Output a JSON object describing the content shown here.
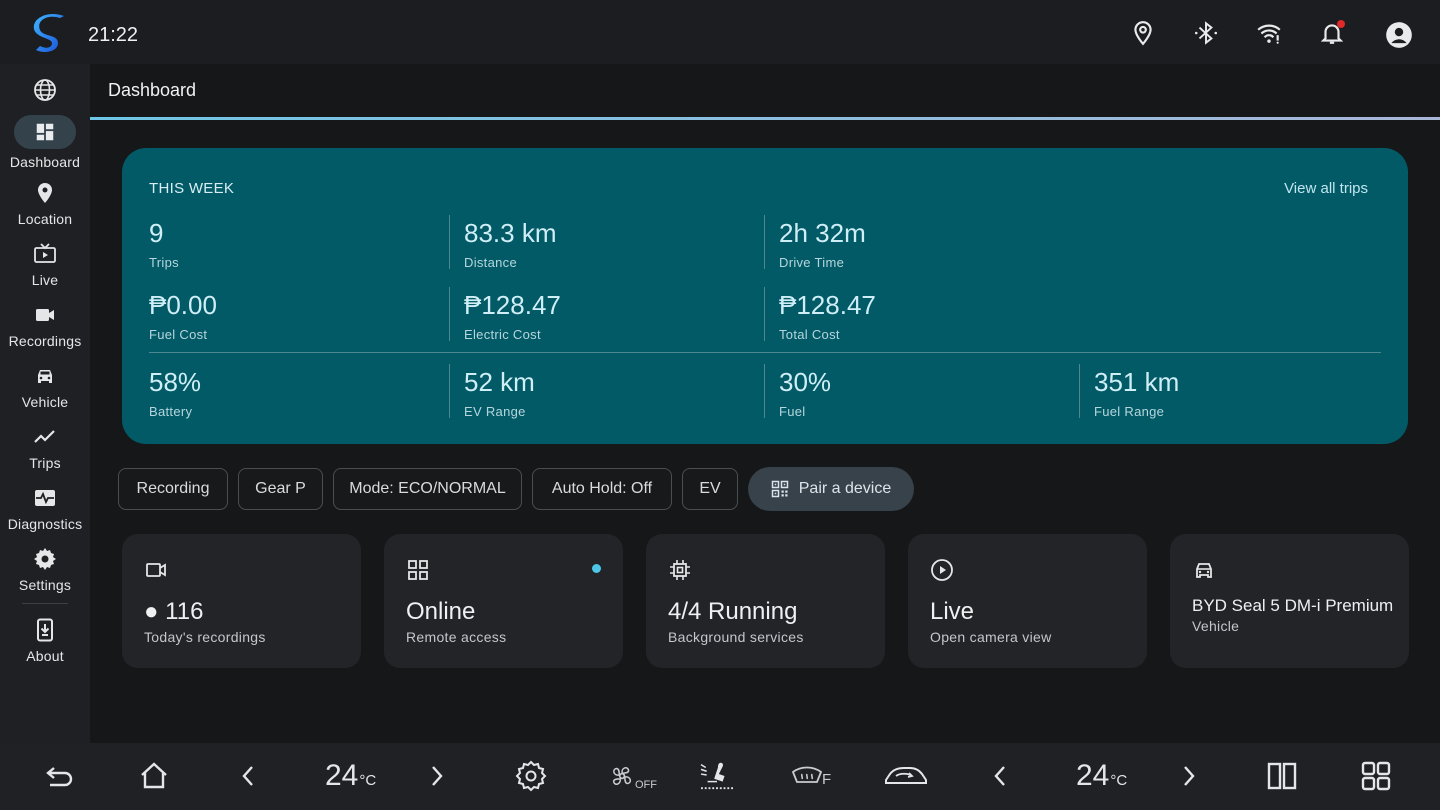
{
  "status_bar": {
    "time": "21:22",
    "icons": [
      "location-pin-icon",
      "bluetooth-icon",
      "wifi-icon",
      "notification-bell-icon",
      "account-icon"
    ],
    "notification_badge_color": "#e02a2a"
  },
  "nav": {
    "items": [
      {
        "icon": "globe-icon",
        "label": ""
      },
      {
        "icon": "dashboard-icon",
        "label": "Dashboard",
        "active": true
      },
      {
        "icon": "location-icon",
        "label": "Location"
      },
      {
        "icon": "live-tv-icon",
        "label": "Live"
      },
      {
        "icon": "video-camera-icon",
        "label": "Recordings"
      },
      {
        "icon": "car-icon",
        "label": "Vehicle"
      },
      {
        "icon": "trend-line-icon",
        "label": "Trips"
      },
      {
        "icon": "monitor-heart-icon",
        "label": "Diagnostics"
      },
      {
        "icon": "gear-icon",
        "label": "Settings"
      },
      {
        "icon": "phone-download-icon",
        "label": "About"
      }
    ]
  },
  "page": {
    "title": "Dashboard"
  },
  "week_card": {
    "label": "THIS WEEK",
    "link": "View all trips",
    "row1": [
      {
        "value": "9",
        "label": "Trips"
      },
      {
        "value": "83.3 km",
        "label": "Distance"
      },
      {
        "value": "2h 32m",
        "label": "Drive Time"
      }
    ],
    "row2": [
      {
        "value": "₱0.00",
        "label": "Fuel Cost"
      },
      {
        "value": "₱128.47",
        "label": "Electric Cost"
      },
      {
        "value": "₱128.47",
        "label": "Total Cost"
      }
    ],
    "row3": [
      {
        "value": "58%",
        "label": "Battery"
      },
      {
        "value": "52 km",
        "label": "EV Range"
      },
      {
        "value": "30%",
        "label": "Fuel"
      },
      {
        "value": "351 km",
        "label": "Fuel Range"
      }
    ],
    "color": "#035a67"
  },
  "chips": [
    "Recording",
    "Gear P",
    "Mode: ECO/NORMAL",
    "Auto Hold: Off",
    "EV"
  ],
  "pair_button": {
    "label": "Pair a device",
    "icon": "qr-code-icon"
  },
  "tiles": [
    {
      "icon": "video-camera-icon",
      "value": "● 116",
      "label": "Today's recordings"
    },
    {
      "icon": "apps-grid-icon",
      "value": "Online",
      "label": "Remote access",
      "status_color": "#4cc7e8"
    },
    {
      "icon": "cpu-chip-icon",
      "value": "4/4 Running",
      "label": "Background services"
    },
    {
      "icon": "play-circle-icon",
      "value": "Live",
      "label": "Open camera view"
    },
    {
      "icon": "car-icon",
      "value": "BYD Seal 5 DM-i Premium",
      "label": "Vehicle"
    }
  ],
  "bottom_bar": {
    "left_temp": "24",
    "right_temp": "24",
    "temp_unit": "°C",
    "fan_state": "OFF",
    "defrost_label": "F",
    "icons": [
      "back-icon",
      "home-icon",
      "chevron-left-icon",
      "chevron-right-icon",
      "climate-settings-icon",
      "fan-icon",
      "seat-airflow-icon",
      "front-defrost-icon",
      "car-recirculation-icon",
      "chevron-left-icon",
      "chevron-right-icon",
      "split-screen-icon",
      "app-grid-icon"
    ]
  }
}
